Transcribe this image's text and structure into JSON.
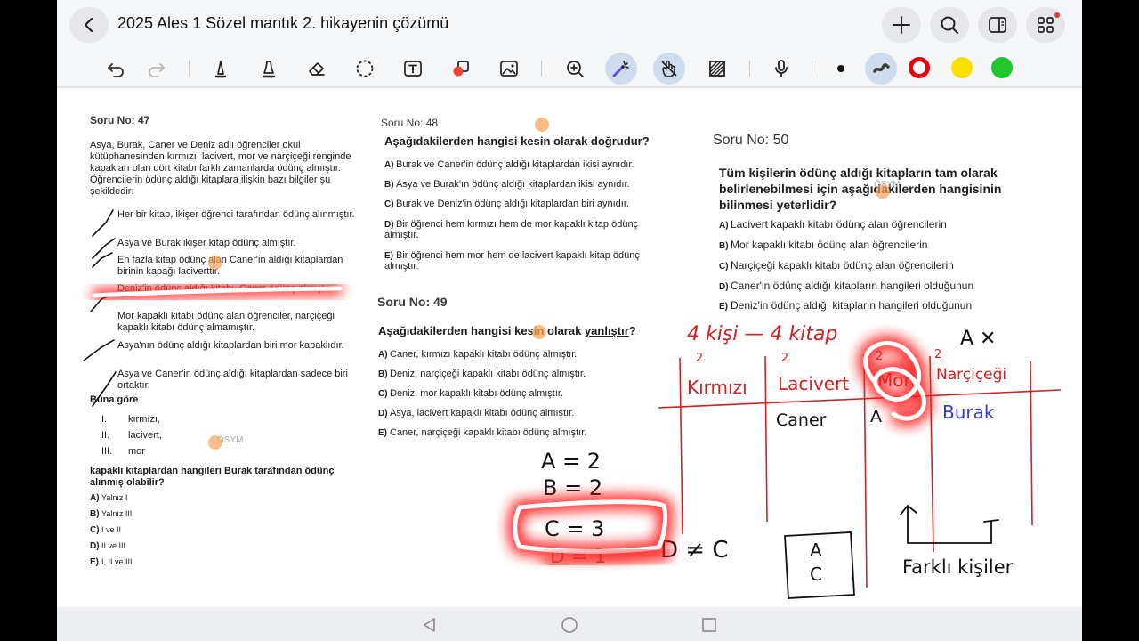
{
  "header": {
    "title": "2025 Ales 1 Sözel mantık 2. hikayenin çözümü"
  },
  "toolbar": {
    "colors": [
      "#111111",
      "#3a3a3a",
      "#e8000b",
      "#f8e000",
      "#21c52c"
    ]
  },
  "q47": {
    "number": "Soru No: 47",
    "body": "Asya, Burak, Caner ve Deniz adlı öğrenciler okul kütüphanesinden kırmızı, lacivert, mor ve narçiçeği renginde kapakları olan dört kitabı farklı zamanlarda ödünç almıştır. Öğrencilerin ödünç aldığı kitaplara ilişkin bazı bilgiler şu şekildedir:",
    "facts": [
      "Her bir kitap, ikişer öğrenci tarafından ödünç alınmıştır.",
      "Asya ve Burak ikişer kitap ödünç almıştır.",
      "En fazla kitap ödünç alan Caner'in aldığı kitaplardan birinin kapağı laciverttir.",
      "Deniz'in ödünç aldığı kitabı, Caner ödünç almıştır.",
      "Mor kapaklı kitabı ödünç alan öğrenciler, narçiçeği kapaklı kitabı ödünç almamıştır.",
      "Asya'nın ödünç aldığı kitaplardan biri mor kapaklıdır.",
      "Asya ve Caner'in ödünç aldığı kitaplardan sadece biri ortaktır."
    ],
    "buna_gore": "Buna göre",
    "roman": [
      "I.",
      "II.",
      "III."
    ],
    "items": [
      "kırmızı,",
      "lacivert,",
      "mor"
    ],
    "watermark": "ÖSYM",
    "question": "kapaklı kitaplardan hangileri Burak tarafından ödünç alınmış olabilir?",
    "letters": [
      "A)",
      "B)",
      "C)",
      "D)",
      "E)"
    ],
    "options": [
      "Yalnız I",
      "Yalnız III",
      "I ve II",
      "II ve III",
      "I, II ve III"
    ]
  },
  "q48": {
    "number": "Soru No: 48",
    "question": "Aşağıdakilerden hangisi kesin olarak doğrudur?",
    "letters": [
      "A)",
      "B)",
      "C)",
      "D)",
      "E)"
    ],
    "options": [
      "Burak ve Caner'in ödünç aldığı kitaplardan ikisi aynıdır.",
      "Asya ve Burak'ın ödünç aldığı kitaplardan ikisi aynıdır.",
      "Burak ve Deniz'in ödünç aldığı kitaplardan biri aynıdır.",
      "Bir öğrenci hem kırmızı hem de mor kapaklı kitap ödünç almıştır.",
      "Bir öğrenci hem mor hem de lacivert kapaklı kitap ödünç almıştır."
    ]
  },
  "q49": {
    "number": "Soru No: 49",
    "question_a": "Aşağıdakilerden hangisi kesin olarak ",
    "question_b": "yanlıştır",
    "question_c": "?",
    "letters": [
      "A)",
      "B)",
      "C)",
      "D)",
      "E)"
    ],
    "options": [
      "Caner, kırmızı kapaklı kitabı ödünç almıştır.",
      "Deniz, narçiçeği kapaklı kitabı ödünç almıştır.",
      "Deniz, mor kapaklı kitabı ödünç almıştır.",
      "Asya, lacivert kapaklı kitabı ödünç almıştır.",
      "Caner, narçiçeği kapaklı kitabı ödünç almıştır."
    ]
  },
  "q50": {
    "number": "Soru No: 50",
    "question": "Tüm kişilerin ödünç aldığı kitapların tam olarak belirlenebilmesi için aşağıdakilerden hangisinin bilinmesi yeterlidir?",
    "watermark": "ÖSYM",
    "letters": [
      "A)",
      "B)",
      "C)",
      "D)",
      "E)"
    ],
    "options": [
      "Lacivert kapaklı kitabı ödünç alan öğrencilerin",
      "Mor kapaklı kitabı ödünç alan öğrencilerin",
      "Narçiçeği kapaklı kitabı ödünç alan öğrencilerin",
      "Caner'in ödünç aldığı kitapların hangileri olduğunun",
      "Deniz'in ödünç aldığı kitapların hangileri olduğunun"
    ]
  },
  "notes": {
    "top": "4 kişi — 4 kitap",
    "ax": "A ✕",
    "cols": [
      "Kırmızı",
      "Lacivert",
      "Mor",
      "Narçiçeği"
    ],
    "twos": [
      "2",
      "2",
      "2",
      "2"
    ],
    "caner": "Caner",
    "asya": "A",
    "burak": "Burak",
    "a2": "A = 2",
    "b2": "B = 2",
    "c3": "C = 3",
    "d1": "D = 1",
    "dnec": "D ≠ C",
    "box_a": "A",
    "box_c": "C",
    "farkli": "Farklı kişiler"
  }
}
